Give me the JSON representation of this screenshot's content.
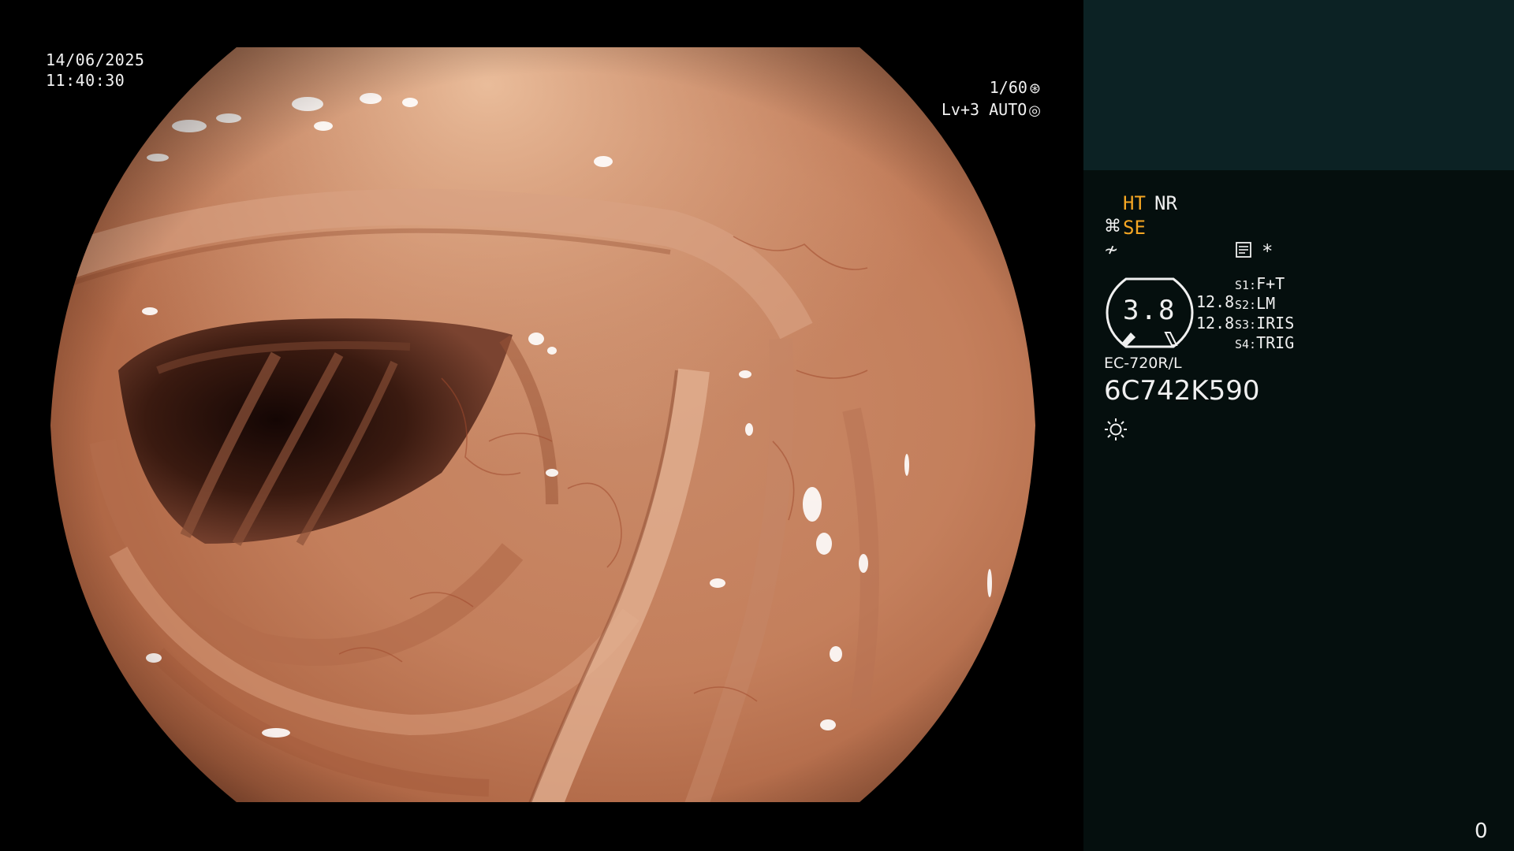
{
  "overlay": {
    "date": "14/06/2025",
    "time": "11:40:30",
    "shutter": "1/60",
    "shutter_icon": "aperture-icon",
    "level": "Lv+3",
    "iris_mode": "AUTO",
    "iris_icon": "iris-icon"
  },
  "panel": {
    "ht_label": "HT",
    "nr_label": "NR",
    "se_icon": "structure-enhancement-icon",
    "se_label": "SE",
    "enhance_icon": "edge-enhance-icon",
    "memo_icon": "memo-icon",
    "star": "*",
    "gauge_value": "3.8",
    "distance_1": "12.8",
    "distance_2": "12.8",
    "switches": [
      {
        "key": "S1:",
        "value": "F+T"
      },
      {
        "key": "S2:",
        "value": "LM"
      },
      {
        "key": "S3:",
        "value": "IRIS"
      },
      {
        "key": "S4:",
        "value": "TRIG"
      }
    ],
    "scope_model": "EC-720R/L",
    "scope_serial": "6C742K590",
    "light_icon": "light-source-icon",
    "counter": "0"
  },
  "colors": {
    "panel_bg": "#050f0e",
    "panel_top_bg": "#0c2224",
    "accent_orange": "#f5a623"
  }
}
